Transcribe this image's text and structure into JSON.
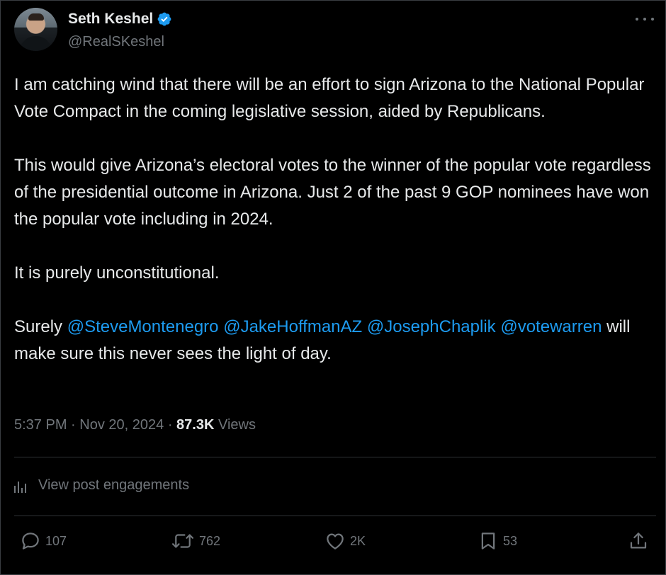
{
  "author": {
    "name": "Seth Keshel",
    "handle": "@RealSKeshel",
    "verified_color": "#1d9bf0"
  },
  "tweet": {
    "paragraph1": "I am catching wind that there will be an effort to sign Arizona to the National Popular Vote Compact in the coming legislative session, aided by Republicans.",
    "paragraph2": "This would give Arizona’s electoral votes to the winner of the popular vote regardless of the presidential outcome in Arizona. Just 2 of the past 9 GOP nominees have won the popular vote including in 2024.",
    "paragraph3": "It is purely unconstitutional.",
    "paragraph4_prefix": "Surely ",
    "mentions": [
      "@SteveMontenegro",
      "@JakeHoffmanAZ",
      "@JosephChaplik",
      "@votewarren"
    ],
    "paragraph4_suffix": " will make sure this never sees the light of day."
  },
  "meta": {
    "time": "5:37 PM",
    "date": "Nov 20, 2024",
    "views_count": "87.3K",
    "views_label": "Views"
  },
  "engagements_label": "View post engagements",
  "actions": {
    "replies": "107",
    "reposts": "762",
    "likes": "2K",
    "bookmarks": "53"
  },
  "icons": {
    "more": "more-horizontal-icon",
    "verified": "verified-badge-icon",
    "engagements": "bar-chart-icon",
    "reply": "reply-bubble-icon",
    "repost": "repost-arrows-icon",
    "like": "heart-icon",
    "bookmark": "bookmark-icon",
    "share": "share-upload-icon"
  },
  "colors": {
    "background": "#000000",
    "text": "#e7e9ea",
    "muted": "#71767b",
    "link": "#1d9bf0"
  }
}
